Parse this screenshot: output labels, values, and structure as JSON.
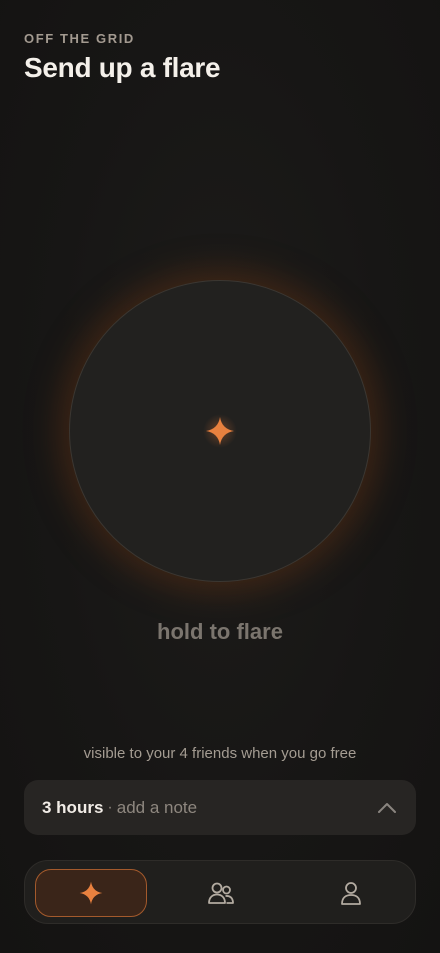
{
  "header": {
    "eyebrow": "OFF THE GRID",
    "title": "Send up a flare"
  },
  "flare": {
    "hold_label": "hold to flare",
    "icon": "sparkle-icon",
    "accent_color": "#e8813f"
  },
  "visibility_text": "visible to your 4 friends when you go free",
  "duration": {
    "hours_label": "3 hours",
    "separator": "·",
    "note_placeholder": "add a note",
    "icon": "chevron-up-icon"
  },
  "tabs": [
    {
      "name": "flare",
      "icon": "sparkle-icon",
      "active": true
    },
    {
      "name": "friends",
      "icon": "friends-icon",
      "active": false
    },
    {
      "name": "profile",
      "icon": "profile-icon",
      "active": false
    }
  ]
}
